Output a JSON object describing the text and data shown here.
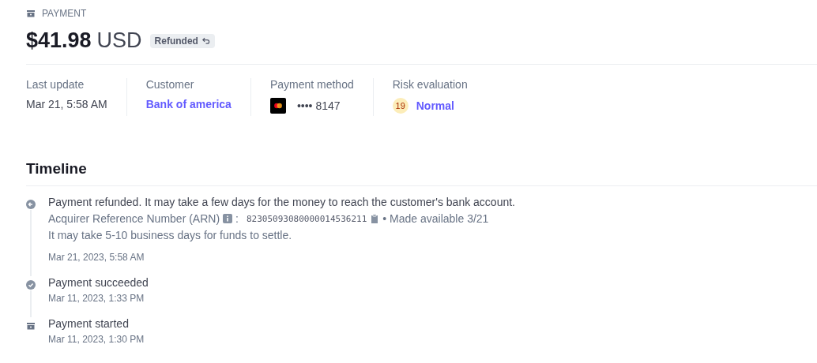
{
  "header": {
    "label": "PAYMENT",
    "amount": "$41.98",
    "currency": "USD",
    "status": "Refunded"
  },
  "summary": [
    {
      "kind": "text",
      "label": "Last update",
      "value": "Mar 21, 5:58 AM"
    },
    {
      "kind": "link",
      "label": "Customer",
      "value": "Bank of america"
    },
    {
      "kind": "card",
      "label": "Payment method",
      "value": "•••• 8147"
    },
    {
      "kind": "risk",
      "label": "Risk evaluation",
      "score": "19",
      "value": "Normal"
    }
  ],
  "timeline": {
    "title": "Timeline",
    "events": [
      {
        "kind": "refund",
        "title": "Payment refunded. It may take a few days for the money to reach the customer's bank account.",
        "arn_label": "Acquirer Reference Number (ARN)",
        "arn_separator": ":",
        "arn": "82305093080000014536211",
        "available": "• Made available 3/21",
        "note": "It may take 5-10 business days for funds to settle.",
        "time": "Mar 21, 2023, 5:58 AM"
      },
      {
        "kind": "success",
        "title": "Payment succeeded",
        "time": "Mar 11, 2023, 1:33 PM"
      },
      {
        "kind": "started",
        "title": "Payment started",
        "time": "Mar 11, 2023, 1:30 PM"
      }
    ]
  }
}
